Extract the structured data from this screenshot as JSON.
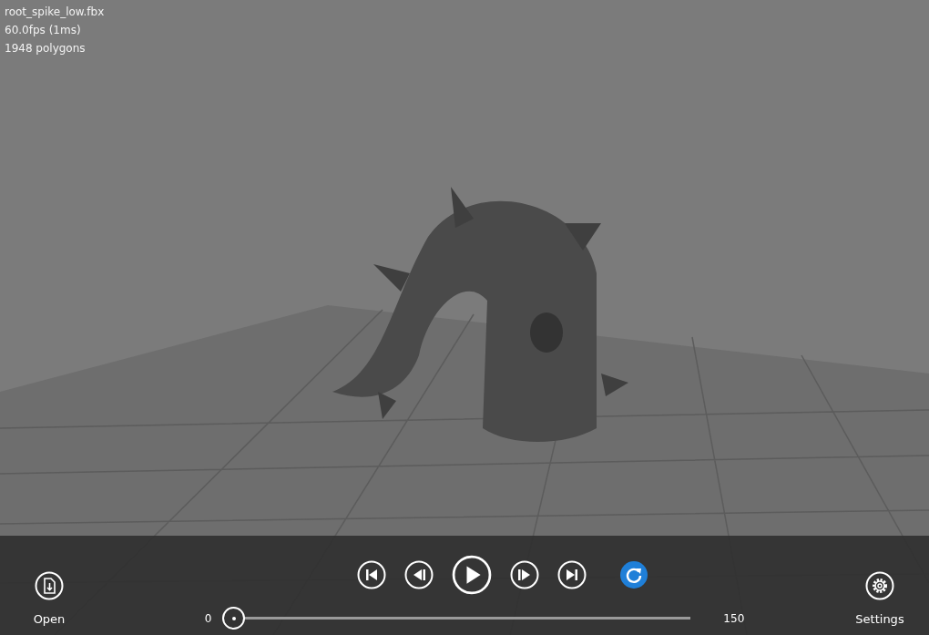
{
  "info": [
    "root_spike_low.fbx",
    "60.0fps (1ms)",
    "1948 polygons"
  ],
  "open_button": {
    "label": "Open"
  },
  "transport": [
    {
      "kind": "first"
    },
    {
      "kind": "prev"
    },
    {
      "kind": "play"
    },
    {
      "kind": "next"
    },
    {
      "kind": "last"
    }
  ],
  "loop_toggle": {
    "on": true
  },
  "timeline": {
    "start": "0",
    "end": "150",
    "level": 0
  },
  "settings_button": {
    "label": "Settings"
  }
}
